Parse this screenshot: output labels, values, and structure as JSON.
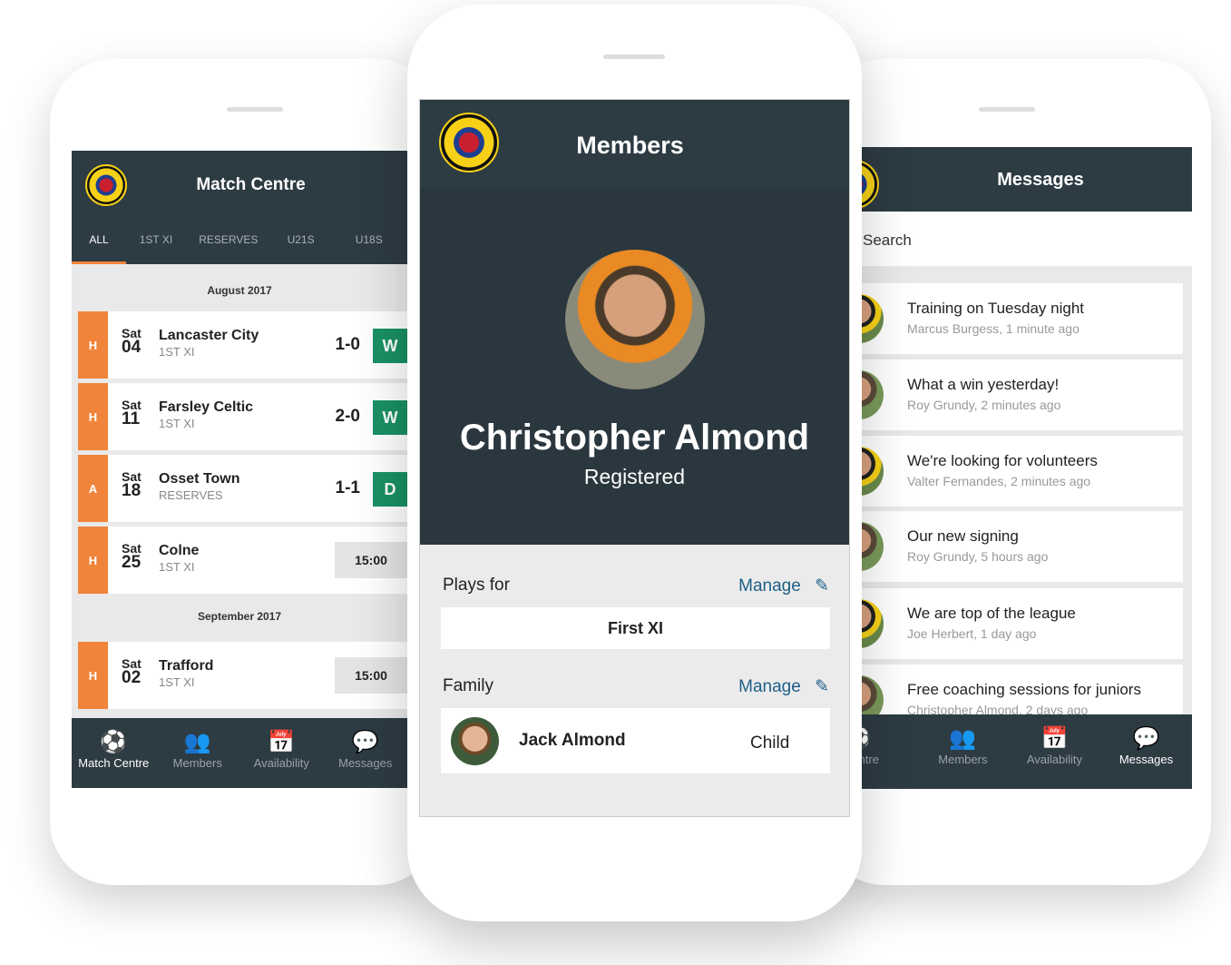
{
  "match_centre": {
    "title": "Match Centre",
    "tabs": [
      "ALL",
      "1ST XI",
      "RESERVES",
      "U21S",
      "U18S"
    ],
    "months": [
      "August 2017",
      "September 2017"
    ],
    "fixtures": [
      {
        "venue": "H",
        "day": "Sat",
        "date": "04",
        "team": "Lancaster City",
        "squad": "1ST XI",
        "score": "1-0",
        "result": "W"
      },
      {
        "venue": "H",
        "day": "Sat",
        "date": "11",
        "team": "Farsley Celtic",
        "squad": "1ST XI",
        "score": "2-0",
        "result": "W"
      },
      {
        "venue": "A",
        "day": "Sat",
        "date": "18",
        "team": "Osset Town",
        "squad": "RESERVES",
        "score": "1-1",
        "result": "D"
      },
      {
        "venue": "H",
        "day": "Sat",
        "date": "25",
        "team": "Colne",
        "squad": "1ST XI",
        "time": "15:00"
      },
      {
        "venue": "H",
        "day": "Sat",
        "date": "02",
        "team": "Trafford",
        "squad": "1ST XI",
        "time": "15:00"
      }
    ],
    "nav": [
      "Match Centre",
      "Members",
      "Availability",
      "Messages"
    ]
  },
  "members": {
    "title": "Members",
    "name": "Christopher Almond",
    "status": "Registered",
    "plays_for_label": "Plays for",
    "manage": "Manage",
    "team": "First XI",
    "family_label": "Family",
    "family": [
      {
        "name": "Jack Almond",
        "relation": "Child"
      }
    ]
  },
  "messages": {
    "title": "Messages",
    "search": "Search",
    "items": [
      {
        "title": "Training on Tuesday night",
        "sub": "Marcus Burgess, 1 minute ago"
      },
      {
        "title": "What a win yesterday!",
        "sub": "Roy Grundy, 2 minutes ago"
      },
      {
        "title": "We're looking for volunteers",
        "sub": "Valter Fernandes, 2 minutes ago"
      },
      {
        "title": "Our new signing",
        "sub": "Roy Grundy, 5 hours ago"
      },
      {
        "title": "We are top of the league",
        "sub": "Joe Herbert, 1 day ago"
      },
      {
        "title": "Free coaching sessions for juniors",
        "sub": "Christopher Almond, 2 days ago"
      }
    ],
    "nav": [
      "Centre",
      "Members",
      "Availability",
      "Messages"
    ]
  },
  "colors": {
    "header": "#2d3b43",
    "accent": "#f0843a",
    "win": "#1a9164",
    "link": "#1d5f88"
  }
}
